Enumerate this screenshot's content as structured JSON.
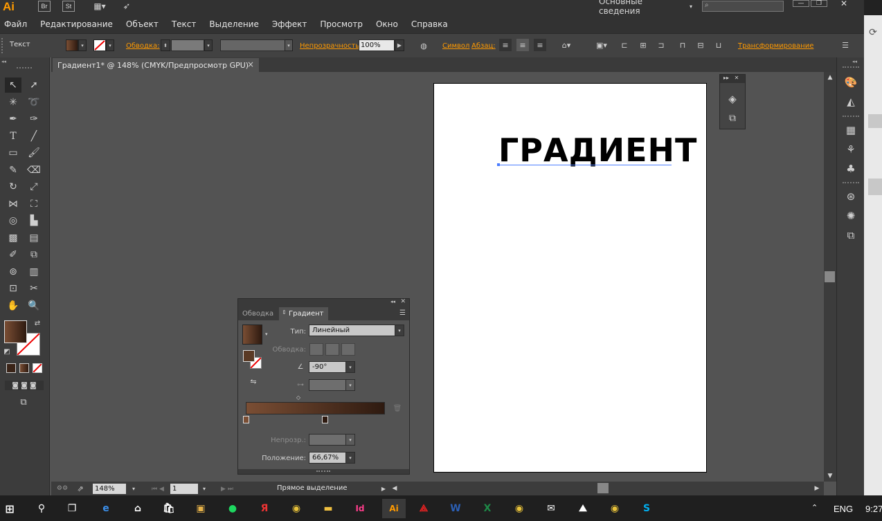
{
  "app": {
    "badge": "Ai",
    "bridge": "Br",
    "stock": "St",
    "workspace": "Основные сведения",
    "window_minimize": "—",
    "window_restore": "❐",
    "window_close": "✕"
  },
  "menu": [
    "Файл",
    "Редактирование",
    "Объект",
    "Текст",
    "Выделение",
    "Эффект",
    "Просмотр",
    "Окно",
    "Справка"
  ],
  "control": {
    "context_label": "Текст",
    "stroke_label": "Обводка:",
    "opacity_label": "Непрозрачность:",
    "opacity_value": "100%",
    "symbol_link": "Символ",
    "paragraph_link": "Абзац:",
    "transform_link": "Трансформирование"
  },
  "document": {
    "tab_title": "Градиент1* @ 148% (CMYK/Предпросмотр GPU)",
    "tab_close": "×",
    "artboard_text": "ГРАДИЕНТ"
  },
  "status": {
    "zoom": "148%",
    "page": "1",
    "tool_label": "Прямое выделение"
  },
  "gradient_panel": {
    "tab_stroke": "Обводка",
    "tab_gradient": "Градиент",
    "type_label": "Тип:",
    "type_value": "Линейный",
    "stroke_label": "Обводка:",
    "angle_value": "-90°",
    "opacity_label": "Непрозр.:",
    "position_label": "Положение:",
    "position_value": "66,67%",
    "gradient_start_color": "#7a4e34",
    "gradient_end_color": "#2e1a10",
    "stop_1_location": 0,
    "stop_2_location": 0.5667
  },
  "colors": {
    "fill_swatch": "#5a3a25",
    "accent_orange": "#ff9a00",
    "selection_blue": "#4a7cff"
  },
  "taskbar": {
    "language": "ENG",
    "time": "9:27",
    "apps": [
      "windows-start-icon",
      "search-icon",
      "task-view-icon",
      "edge-icon",
      "home-icon",
      "store-icon",
      "notes-icon",
      "spotify-icon",
      "yandex-icon",
      "chrome-icon",
      "explorer-icon",
      "indesign-icon",
      "illustrator-icon",
      "acrobat-icon",
      "word-icon",
      "excel-icon",
      "photo-icon",
      "mail-icon",
      "image-icon",
      "chrome-icon-2",
      "skype-icon"
    ]
  }
}
